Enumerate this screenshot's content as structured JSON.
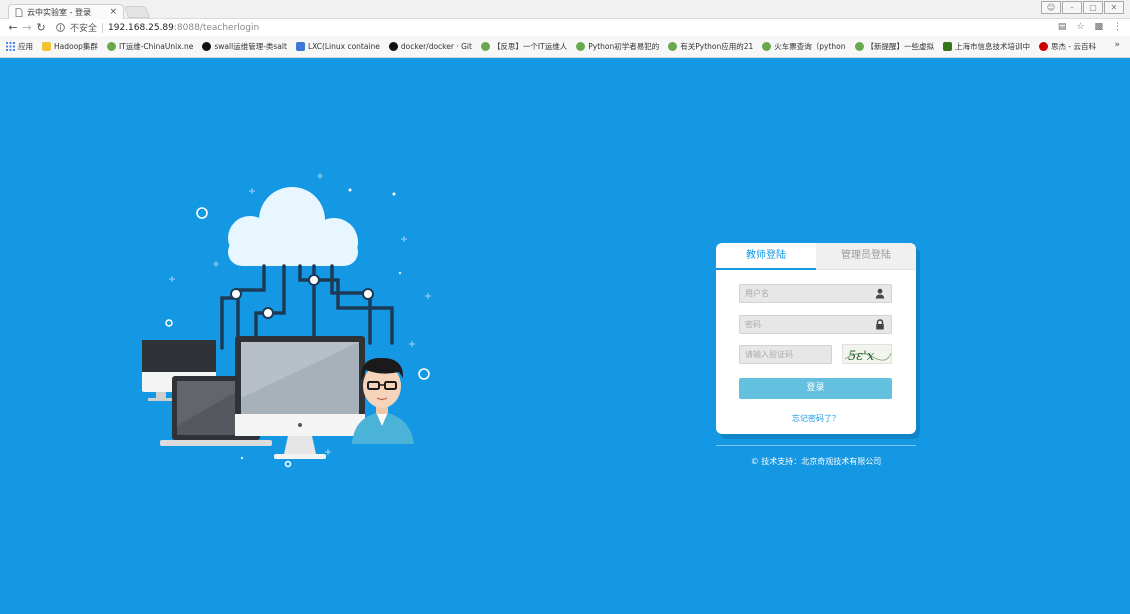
{
  "browser": {
    "tab_title": "云中实验室 - 登录",
    "tab_close": "×",
    "secure_label": "不安全",
    "url_host": "192.168.25.89",
    "url_rest": ":8088/teacherlogin",
    "bookmarks": [
      {
        "label": "应用",
        "color": "#4a86e8"
      },
      {
        "label": "Hadoop集群",
        "color": "#f1c232"
      },
      {
        "label": "IT运维-ChinaUnix.ne",
        "color": "#6aa84f"
      },
      {
        "label": "swall运维管理-类salt",
        "color": "#111111"
      },
      {
        "label": "LXC(Linux containe",
        "color": "#3c78d8"
      },
      {
        "label": "docker/docker · Git",
        "color": "#111111"
      },
      {
        "label": "【反思】一个IT运维人",
        "color": "#6aa84f"
      },
      {
        "label": "Python初学者易犯的",
        "color": "#6aa84f"
      },
      {
        "label": "有关Python应用的21",
        "color": "#6aa84f"
      },
      {
        "label": "火车票查询（python",
        "color": "#6aa84f"
      },
      {
        "label": "【新提醒】一些虚拟",
        "color": "#6aa84f"
      },
      {
        "label": "上海市信息技术培训中",
        "color": "#38761d"
      },
      {
        "label": "思杰 - 云百科",
        "color": "#cc0000"
      }
    ],
    "more": "»"
  },
  "login": {
    "tab_teacher": "教师登陆",
    "tab_admin": "管理员登陆",
    "username_placeholder": "用户名",
    "password_placeholder": "密码",
    "captcha_placeholder": "请输入验证码",
    "captcha_text": "5ε'x",
    "submit_label": "登录",
    "forgot_label": "忘记密码了？"
  },
  "footer": {
    "copyright": "© 技术支持：北京奇观技术有限公司"
  },
  "colors": {
    "page_bg": "#1598e3",
    "accent": "#1598e3",
    "button": "#63c0df"
  }
}
